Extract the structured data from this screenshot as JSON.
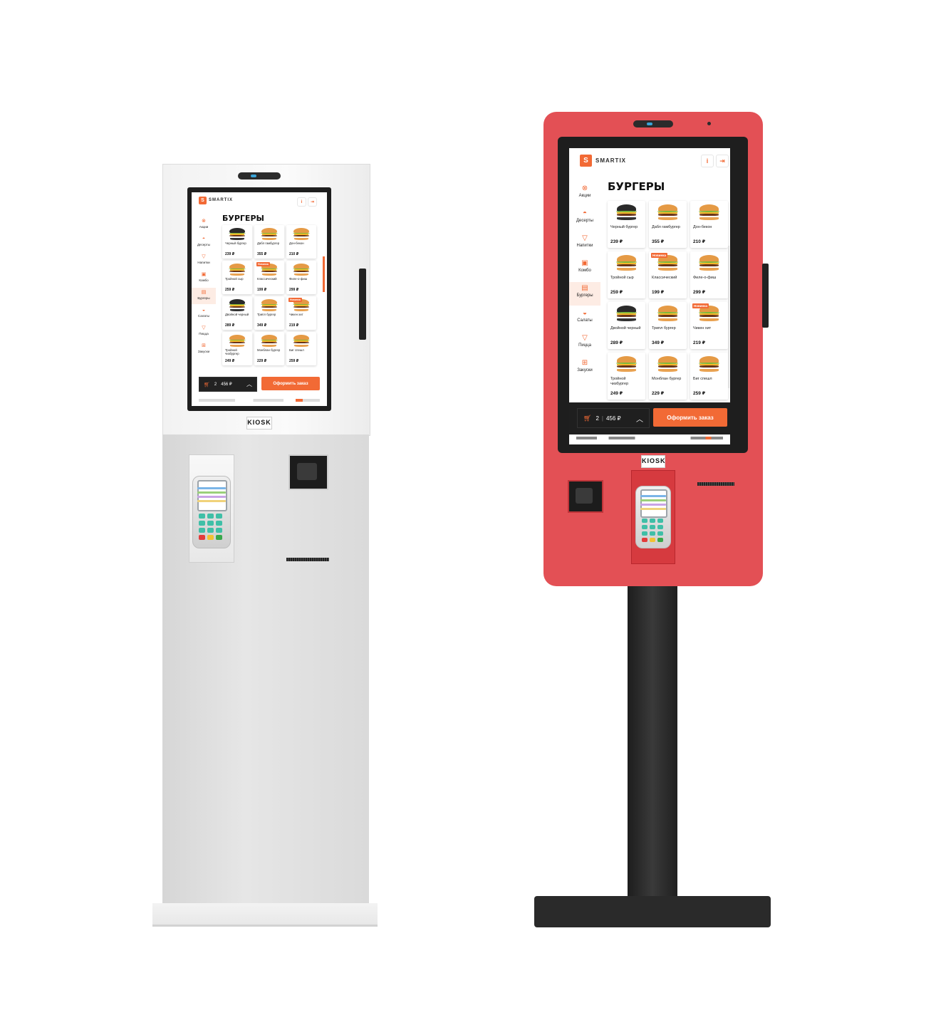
{
  "brand": {
    "name": "SMARTIX",
    "accent": "#f26a35",
    "kiosk_label": "KIOSK"
  },
  "header": {
    "info_icon": "info-icon",
    "exit_icon": "exit-icon"
  },
  "sidebar": {
    "items": [
      {
        "label": "Акции",
        "icon": "percent-icon"
      },
      {
        "label": "Десерты",
        "icon": "cupcake-icon"
      },
      {
        "label": "Напитки",
        "icon": "cup-icon"
      },
      {
        "label": "Комбо",
        "icon": "combo-icon"
      },
      {
        "label": "Бургеры",
        "icon": "burger-icon",
        "active": true
      },
      {
        "label": "Салаты",
        "icon": "salad-icon"
      },
      {
        "label": "Пицца",
        "icon": "pizza-icon"
      },
      {
        "label": "Закуски",
        "icon": "snack-icon"
      }
    ]
  },
  "section_title": "БУРГЕРЫ",
  "products": [
    {
      "name": "Черный бургер",
      "price": "239 ₽",
      "style": "dark"
    },
    {
      "name": "Дабл гамбургер",
      "price": "355 ₽",
      "style": "classic"
    },
    {
      "name": "Дон-бекон",
      "price": "210 ₽",
      "style": "classic"
    },
    {
      "name": "Тройной сыр",
      "price": "259 ₽",
      "style": "classic"
    },
    {
      "name": "Классический",
      "price": "199 ₽",
      "style": "classic",
      "badge": "Новинка"
    },
    {
      "name": "Филе-о-фиш",
      "price": "299 ₽",
      "style": "classic"
    },
    {
      "name": "Двойной черный",
      "price": "289 ₽",
      "style": "dark"
    },
    {
      "name": "Трипл бургер",
      "price": "349 ₽",
      "style": "classic"
    },
    {
      "name": "Чикен хит",
      "price": "219 ₽",
      "style": "classic",
      "badge": "Новинка"
    },
    {
      "name": "Тройной чизбургер",
      "price": "249 ₽",
      "style": "classic"
    },
    {
      "name": "Монблан бургер",
      "price": "229 ₽",
      "style": "classic"
    },
    {
      "name": "Биг спешл",
      "price": "259 ₽",
      "style": "classic"
    }
  ],
  "cart": {
    "count": "2",
    "total": "456 ₽",
    "cart_icon": "cart-icon",
    "expand_icon": "chevron-up-icon"
  },
  "order_button": "Оформить заказ",
  "colors": {
    "kiosk_white_body": "#e4e4e4",
    "kiosk_red_body": "#e35055",
    "stand_black": "#2a2a2a"
  }
}
